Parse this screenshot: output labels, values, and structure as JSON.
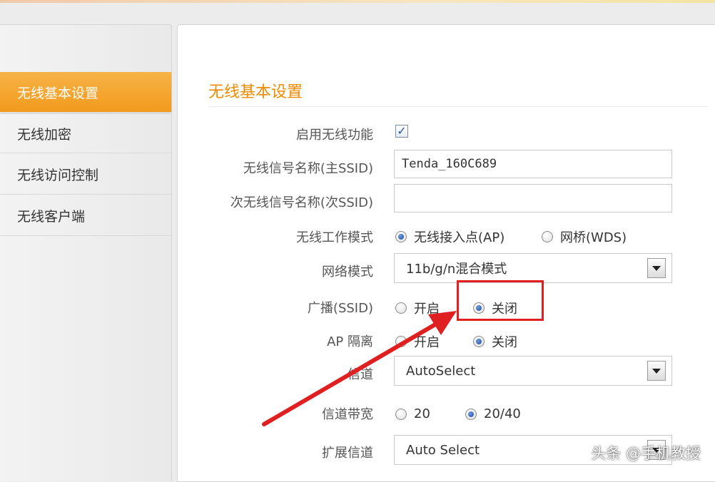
{
  "sidebar": {
    "items": [
      {
        "label": "无线基本设置",
        "active": true
      },
      {
        "label": "无线加密",
        "active": false
      },
      {
        "label": "无线访问控制",
        "active": false
      },
      {
        "label": "无线客户端",
        "active": false
      }
    ]
  },
  "main": {
    "title": "无线基本设置",
    "enable_wireless": {
      "label": "启用无线功能",
      "checked": true
    },
    "ssid_main": {
      "label": "无线信号名称(主SSID)",
      "value": "Tenda_160C689"
    },
    "ssid_secondary": {
      "label": "次无线信号名称(次SSID)",
      "value": ""
    },
    "work_mode": {
      "label": "无线工作模式",
      "options": [
        "无线接入点(AP)",
        "网桥(WDS)"
      ],
      "selected": "无线接入点(AP)"
    },
    "network_mode": {
      "label": "网络模式",
      "value": "11b/g/n混合模式"
    },
    "broadcast": {
      "label": "广播(SSID)",
      "options": [
        "开启",
        "关闭"
      ],
      "selected": "关闭"
    },
    "ap_isolation": {
      "label": "AP 隔离",
      "options": [
        "开启",
        "关闭"
      ],
      "selected": "关闭"
    },
    "channel": {
      "label": "信道",
      "value": "AutoSelect"
    },
    "bandwidth": {
      "label": "信道带宽",
      "options": [
        "20",
        "20/40"
      ],
      "selected": "20/40"
    },
    "ext_channel": {
      "label": "扩展信道",
      "value": "Auto Select"
    }
  },
  "watermark": "头条 @手机教授",
  "colors": {
    "accent": "#f29a1c",
    "title": "#f08a00",
    "highlight": "#e02020"
  }
}
